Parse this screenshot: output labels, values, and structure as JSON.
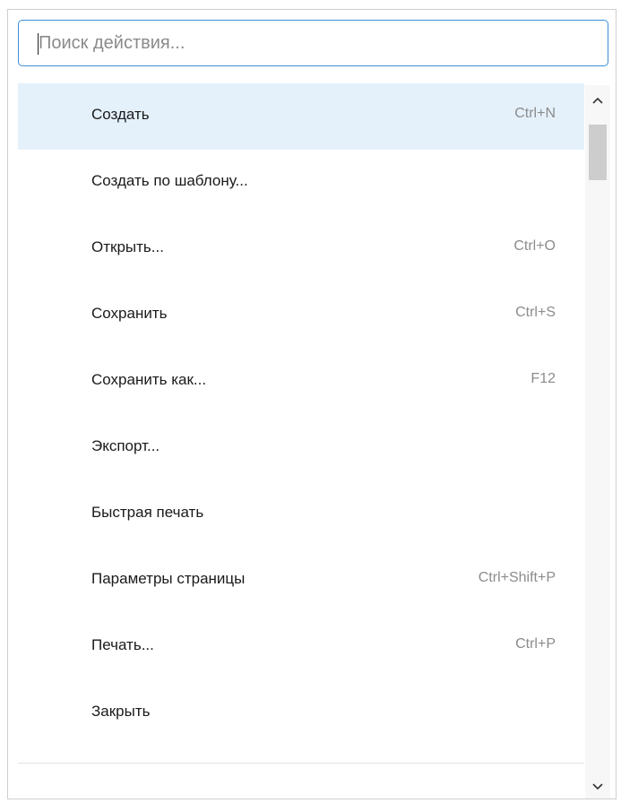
{
  "search": {
    "placeholder": "Поиск действия...",
    "value": ""
  },
  "actions": [
    {
      "label": "Создать",
      "shortcut": "Ctrl+N",
      "selected": true
    },
    {
      "label": "Создать по шаблону...",
      "shortcut": ""
    },
    {
      "label": "Открыть...",
      "shortcut": "Ctrl+O"
    },
    {
      "label": "Сохранить",
      "shortcut": "Ctrl+S"
    },
    {
      "label": "Сохранить как...",
      "shortcut": "F12"
    },
    {
      "label": "Экспорт...",
      "shortcut": ""
    },
    {
      "label": "Быстрая печать",
      "shortcut": ""
    },
    {
      "label": "Параметры страницы",
      "shortcut": "Ctrl+Shift+P"
    },
    {
      "label": "Печать...",
      "shortcut": "Ctrl+P"
    },
    {
      "label": "Закрыть",
      "shortcut": ""
    }
  ],
  "scrollbar": {
    "up_icon": "chevron-up-icon",
    "down_icon": "chevron-down-icon"
  },
  "colors": {
    "selected_background": "#e4f1fb",
    "focus_border": "#3b8fd6",
    "shortcut_text": "#8c8c8c"
  }
}
